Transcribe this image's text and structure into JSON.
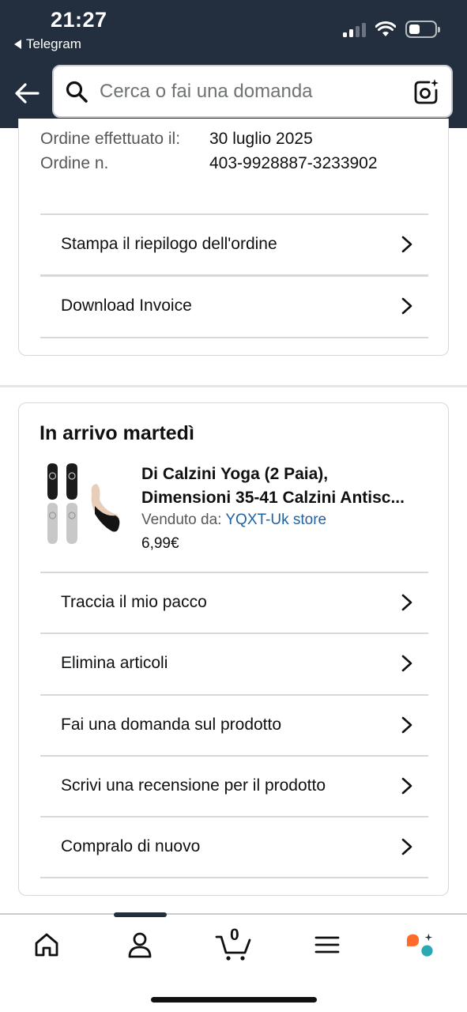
{
  "status_bar": {
    "time": "21:27",
    "back_app": "Telegram"
  },
  "header": {
    "search_placeholder": "Cerca o fai una domanda"
  },
  "order": {
    "date_label": "Ordine effettuato il:",
    "date_value": "30 luglio 2025",
    "number_label": "Ordine n.",
    "number_value": "403-9928887-3233902",
    "actions": [
      {
        "label": "Stampa il riepilogo dell'ordine"
      },
      {
        "label": "Download Invoice"
      }
    ]
  },
  "shipment": {
    "heading": "In arrivo martedì",
    "product": {
      "title_line1": "Di Calzini Yoga (2 Paia),",
      "title_line2": "Dimensioni 35-41 Calzini Antisc...",
      "seller_label": "Venduto da:",
      "seller_name": "YQXT-Uk store",
      "price": "6,99€"
    },
    "actions": [
      {
        "label": "Traccia il mio pacco"
      },
      {
        "label": "Elimina articoli"
      },
      {
        "label": "Fai una domanda sul prodotto"
      },
      {
        "label": "Scrivi una recensione per il prodotto"
      },
      {
        "label": "Compralo di nuovo"
      }
    ]
  },
  "bottom_nav": {
    "cart_count": "0",
    "items": [
      "home-icon",
      "account-icon",
      "cart-icon",
      "menu-icon",
      "rufus-icon"
    ]
  },
  "colors": {
    "header_bg": "#232f3e",
    "link": "#2162a1",
    "rufus_orange": "#ff6a2b",
    "rufus_teal": "#2aa8b3"
  }
}
